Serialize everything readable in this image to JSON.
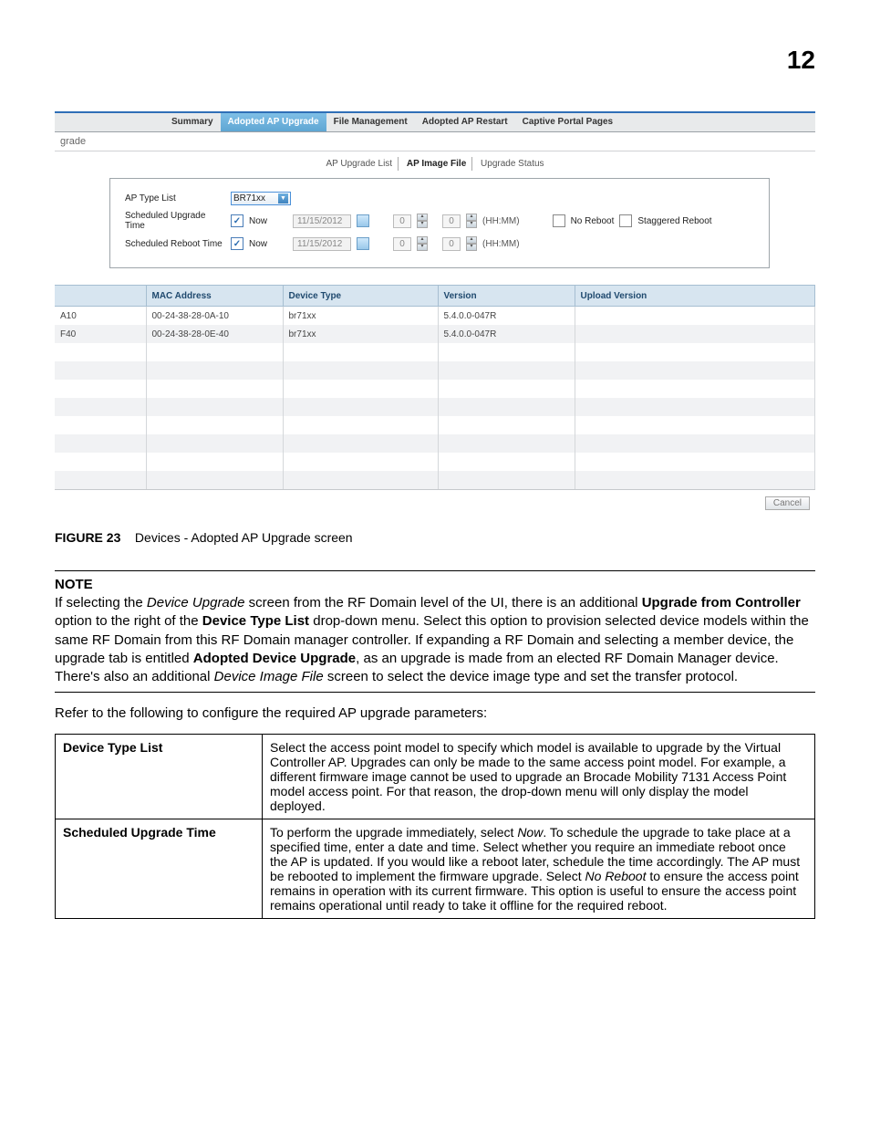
{
  "page_number": "12",
  "tabs": [
    "Summary",
    "Adopted AP Upgrade",
    "File Management",
    "Adopted AP Restart",
    "Captive Portal Pages"
  ],
  "active_tab_index": 1,
  "breadcrumb_fragment": "grade",
  "subtabs": [
    "AP Upgrade List",
    "AP Image File",
    "Upgrade Status"
  ],
  "active_subtab_index": 1,
  "config": {
    "ap_type_list_label": "AP Type List",
    "ap_type_value": "BR71xx",
    "sched_upgrade_label": "Scheduled Upgrade Time",
    "sched_reboot_label": "Scheduled Reboot Time",
    "now_label": "Now",
    "date_value": "11/15/2012",
    "hour_value": "0",
    "min_value": "0",
    "hhmm_label": "(HH:MM)",
    "no_reboot_label": "No Reboot",
    "staggered_label": "Staggered Reboot"
  },
  "table": {
    "headers": [
      "",
      "MAC Address",
      "Device Type",
      "Version",
      "Upload Version"
    ],
    "rows": [
      {
        "c0": "A10",
        "mac": "00-24-38-28-0A-10",
        "type": "br71xx",
        "ver": "5.4.0.0-047R",
        "upload": ""
      },
      {
        "c0": "F40",
        "mac": "00-24-38-28-0E-40",
        "type": "br71xx",
        "ver": "5.4.0.0-047R",
        "upload": ""
      }
    ],
    "empty_row_count": 8,
    "cancel_label": "Cancel"
  },
  "figure": {
    "label": "FIGURE 23",
    "caption": "Devices - Adopted AP Upgrade screen"
  },
  "note": {
    "heading": "NOTE",
    "text_plain": "If selecting the Device Upgrade screen from the RF Domain level of the UI, there is an additional Upgrade from Controller option to the right of the Device Type List drop-down menu. Select this option to provision selected device models within the same RF Domain from this RF Domain manager controller.  If expanding a RF Domain and selecting a member device, the upgrade tab is entitled Adopted Device Upgrade, as an upgrade is made from an elected RF Domain Manager device. There's also an additional Device Image File screen to select the device image type and set the transfer protocol.",
    "seg": {
      "a": "If selecting the ",
      "b": "Device Upgrade",
      "c": " screen from the RF Domain level of the UI, there is an additional ",
      "d": "Upgrade from Controller",
      "e": " option to the right of the ",
      "f": "Device Type List",
      "g": " drop-down menu. Select this option to provision selected device models within the same RF Domain from this RF Domain manager controller.  If expanding a RF Domain and selecting a member device, the upgrade tab is entitled ",
      "h": "Adopted Device Upgrade",
      "i": ", as an upgrade is made from an elected RF Domain Manager device. There's also an additional ",
      "j": "Device Image File",
      "k": " screen to select the device image type and set the transfer protocol."
    }
  },
  "intro_para": "Refer to the following to configure the required AP upgrade parameters:",
  "def_table": [
    {
      "term": "Device Type List",
      "desc": "Select the access point model to specify which model is available to upgrade by the Virtual Controller AP. Upgrades can only be made to the same access point model. For example, a different firmware image cannot be used to upgrade an Brocade Mobility 7131 Access Point model access point. For that reason, the drop-down menu will only display the model deployed."
    },
    {
      "term": "Scheduled Upgrade Time",
      "desc_plain": "To perform the upgrade immediately, select Now. To schedule the upgrade to take place at a specified time, enter a date and time. Select whether you require an immediate reboot once the AP is updated. If you would like a reboot later, schedule the time accordingly. The AP must be rebooted to implement the firmware upgrade. Select No Reboot to ensure the access point remains in operation with its current firmware. This option is useful to ensure the access point remains operational until ready to take it offline for the required reboot.",
      "seg": {
        "a": "To perform the upgrade immediately, select ",
        "b": "Now",
        "c": ". To schedule the upgrade to take place at a specified time, enter a date and time. Select whether you require an immediate reboot once the AP is updated. If you would like a reboot later, schedule the time accordingly. The AP must be rebooted to implement the firmware upgrade. Select ",
        "d": "No Reboot",
        "e": " to ensure the access point remains in operation with its current firmware. This option is useful to ensure the access point remains operational until ready to take it offline for the required reboot."
      }
    }
  ]
}
